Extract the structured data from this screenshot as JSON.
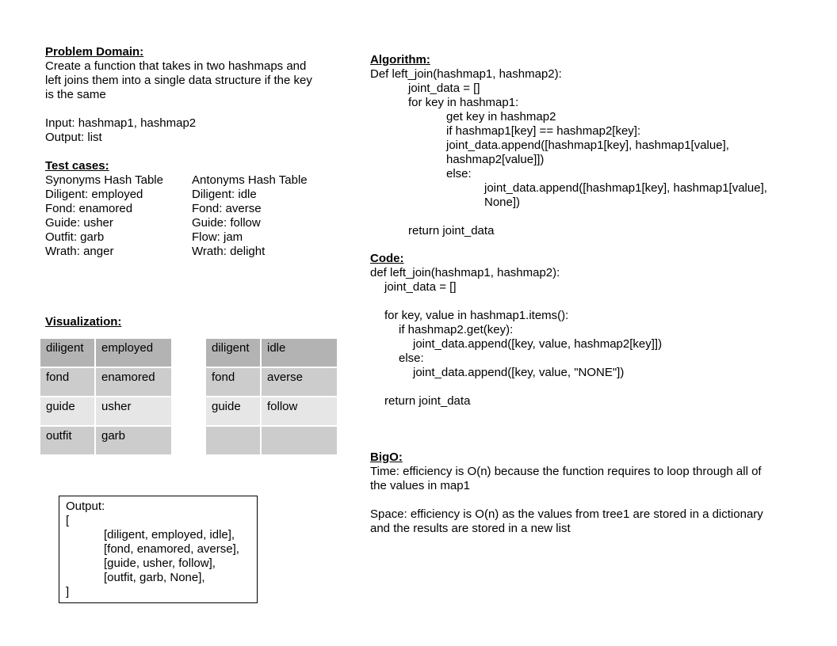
{
  "problem": {
    "heading": "Problem Domain:",
    "desc": [
      "Create a function that takes in two hashmaps and",
      "left joins them into a single data structure if the key",
      "is the same"
    ],
    "input": "Input: hashmap1, hashmap2",
    "output": "Output: list"
  },
  "tests": {
    "heading": "Test cases:",
    "synonyms": {
      "title": "Synonyms Hash Table",
      "rows": [
        "Diligent: employed",
        "Fond: enamored",
        "Guide: usher",
        "Outfit: garb",
        "Wrath: anger"
      ]
    },
    "antonyms": {
      "title": "Antonyms Hash Table",
      "rows": [
        "Diligent: idle",
        "Fond: averse",
        "Guide: follow",
        "Flow: jam",
        "Wrath: delight"
      ]
    }
  },
  "visualization": {
    "heading": "Visualization: ",
    "table1": [
      {
        "k": "diligent",
        "v": "employed",
        "bg": "#b3b3b3"
      },
      {
        "k": "fond",
        "v": "enamored",
        "bg": "#cccccc"
      },
      {
        "k": "guide",
        "v": "usher",
        "bg": "#e6e6e6"
      },
      {
        "k": "outfit",
        "v": "garb",
        "bg": "#cccccc"
      }
    ],
    "table2": [
      {
        "k": "diligent",
        "v": "idle",
        "bg": "#b3b3b3"
      },
      {
        "k": "fond",
        "v": "averse",
        "bg": "#cccccc"
      },
      {
        "k": "guide",
        "v": "follow",
        "bg": "#e6e6e6"
      },
      {
        "k": "",
        "v": "",
        "bg": "#cccccc"
      }
    ]
  },
  "output_box": {
    "lines": [
      "Output:",
      "[",
      "[diligent, employed, idle],",
      "[fond, enamored, averse],",
      "[guide, usher, follow],",
      "[outfit, garb, None],",
      "]"
    ]
  },
  "algorithm": {
    "heading": "Algorithm:",
    "lines": [
      {
        "t": "Def left_join(hashmap1, hashmap2):",
        "i": 0
      },
      {
        "t": "joint_data = []",
        "i": 1
      },
      {
        "t": "for key in hashmap1:",
        "i": 1
      },
      {
        "t": "get key in hashmap2",
        "i": 2
      },
      {
        "t": "if hashmap1[key] == hashmap2[key]:",
        "i": 2
      },
      {
        "t": "joint_data.append([hashmap1[key], hashmap1[value],",
        "i": 2
      },
      {
        "t": "hashmap2[value]])",
        "i": 2
      },
      {
        "t": "else:",
        "i": 2
      },
      {
        "t": "joint_data.append([hashmap1[key], hashmap1[value],",
        "i": 3
      },
      {
        "t": "None])",
        "i": 3
      },
      {
        "t": "",
        "i": 0
      },
      {
        "t": "return joint_data",
        "i": 1
      }
    ]
  },
  "code": {
    "heading": "Code:",
    "lines": [
      {
        "t": "def left_join(hashmap1, hashmap2):",
        "i": 0
      },
      {
        "t": "joint_data = []",
        "i": 1
      },
      {
        "t": "",
        "i": 0
      },
      {
        "t": "for key, value in hashmap1.items():",
        "i": 1
      },
      {
        "t": "if hashmap2.get(key):",
        "i": 2
      },
      {
        "t": "joint_data.append([key, value, hashmap2[key]])",
        "i": 3
      },
      {
        "t": "else:",
        "i": 2
      },
      {
        "t": "joint_data.append([key, value, \"NONE\"])",
        "i": 3
      },
      {
        "t": "",
        "i": 0
      },
      {
        "t": "return joint_data",
        "i": 1
      }
    ]
  },
  "bigo": {
    "heading": "BigO:",
    "time": [
      "Time: efficiency is O(n) because the function requires to loop through all of",
      "the values in map1"
    ],
    "space": [
      "Space: efficiency is O(n) as the values from tree1 are stored in a dictionary",
      "and the results are stored in a new list"
    ]
  }
}
